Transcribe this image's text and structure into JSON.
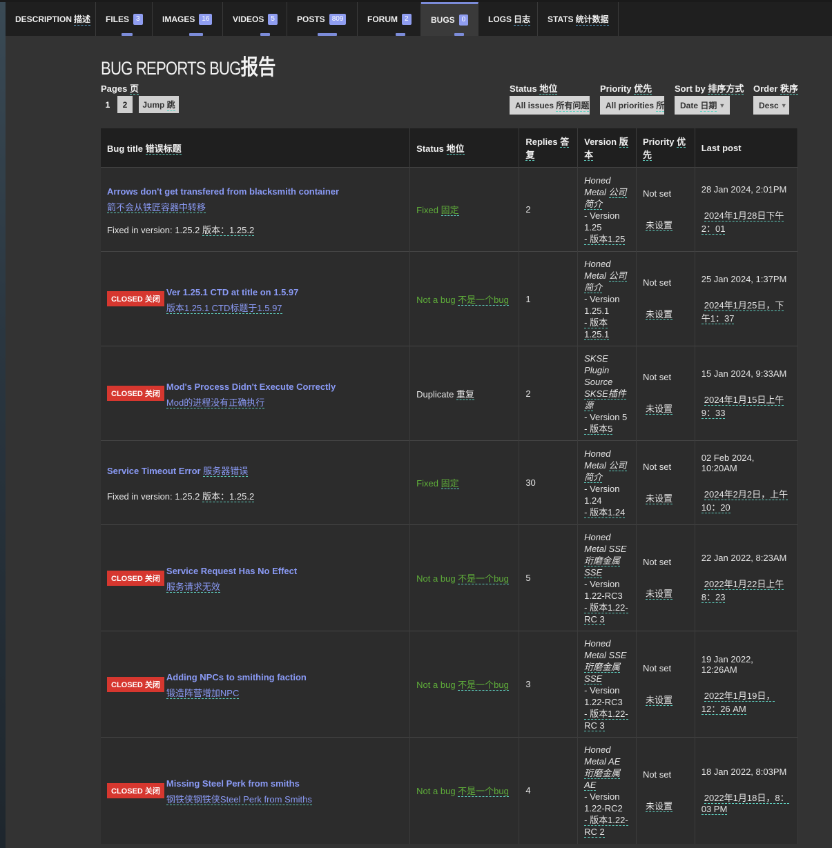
{
  "tabs": [
    {
      "label": "DESCRIPTION",
      "cn": "描述",
      "badge": ""
    },
    {
      "label": "FILES",
      "cn": "",
      "badge": "3"
    },
    {
      "label": "IMAGES",
      "cn": "",
      "badge": "16"
    },
    {
      "label": "VIDEOS",
      "cn": "",
      "badge": "5"
    },
    {
      "label": "POSTS",
      "cn": "",
      "badge": "809"
    },
    {
      "label": "FORUM",
      "cn": "",
      "badge": "2"
    },
    {
      "label": "BUGS",
      "cn": "",
      "badge": "0"
    },
    {
      "label": "LOGS",
      "cn": "日志",
      "badge": ""
    },
    {
      "label": "STATS",
      "cn": "统计数据",
      "badge": ""
    }
  ],
  "heading": {
    "en": "BUG REPORTS BUG",
    "cn": "报告"
  },
  "pages": {
    "label": "Pages",
    "label_cn": "页",
    "current": "1",
    "next": "2",
    "jump": "Jump",
    "jump_cn": "跳"
  },
  "filters": {
    "status": {
      "label": "Status",
      "label_cn": "地位",
      "value": "All issues",
      "value_cn": "所有问题"
    },
    "priority": {
      "label": "Priority",
      "label_cn": "优先",
      "value": "All priorities",
      "value_cn": "所"
    },
    "sort": {
      "label": "Sort by",
      "label_cn": "排序方式",
      "value": "Date",
      "value_cn": "日期"
    },
    "order": {
      "label": "Order",
      "label_cn": "秩序",
      "value": "Desc"
    }
  },
  "columns": {
    "title": {
      "en": "Bug title",
      "cn": "错误标题"
    },
    "status": {
      "en": "Status",
      "cn": "地位"
    },
    "replies": {
      "en": "Replies",
      "cn": "答复"
    },
    "version": {
      "en": "Version",
      "cn": "版本"
    },
    "priority": {
      "en": "Priority",
      "cn": "优先"
    },
    "lastpost": {
      "en": "Last post",
      "cn": ""
    }
  },
  "closed_label": {
    "en": "CLOSED",
    "cn": "关闭"
  },
  "rows": [
    {
      "closed": false,
      "title": "Arrows don't get transfered from blacksmith container",
      "title_cn": "箭不会从铁匠容器中转移",
      "fixed_in": "Fixed in version: 1.25.2",
      "fixed_in_cn": "版本：1.25.2",
      "status": "Fixed",
      "status_cn": "固定",
      "status_type": "fixed",
      "replies": "2",
      "ver_name": "Honed Metal",
      "ver_name_cn": "公司简介",
      "ver_line": "- Version 1.25",
      "ver_line_cn": "- 版本1.25",
      "priority": "Not set",
      "priority_cn": "未设置",
      "lastpost": "28 Jan 2024, 2:01PM",
      "lastpost_cn": "2024年1月28日下午2：01"
    },
    {
      "closed": true,
      "title": "Ver 1.25.1 CTD at title on 1.5.97",
      "title_cn": "版本1.25.1 CTD标题于1.5.97",
      "fixed_in": "",
      "fixed_in_cn": "",
      "status": "Not a bug",
      "status_cn": "不是一个bug",
      "status_type": "notbug",
      "replies": "1",
      "ver_name": "Honed Metal",
      "ver_name_cn": "公司简介",
      "ver_line": "- Version 1.25.1",
      "ver_line_cn": "- 版本1.25.1",
      "priority": "Not set",
      "priority_cn": "未设置",
      "lastpost": "25 Jan 2024, 1:37PM",
      "lastpost_cn": "2024年1月25日，下午1：37"
    },
    {
      "closed": true,
      "title": "Mod's Process Didn't Execute Correctly",
      "title_cn": "Mod的进程没有正确执行",
      "fixed_in": "",
      "fixed_in_cn": "",
      "status": "Duplicate",
      "status_cn": "重复",
      "status_type": "dup",
      "replies": "2",
      "ver_name": "SKSE Plugin Source",
      "ver_name_cn": "SKSE插件源",
      "ver_line": "- Version 5",
      "ver_line_cn": "- 版本5",
      "priority": "Not set",
      "priority_cn": "未设置",
      "lastpost": "15 Jan 2024, 9:33AM",
      "lastpost_cn": "2024年1月15日上午9：33"
    },
    {
      "closed": false,
      "title": "Service Timeout Error",
      "title_cn": "服务器错误",
      "fixed_in": "Fixed in version: 1.25.2",
      "fixed_in_cn": "版本：1.25.2",
      "status": "Fixed",
      "status_cn": "固定",
      "status_type": "fixed",
      "replies": "30",
      "ver_name": "Honed Metal",
      "ver_name_cn": "公司简介",
      "ver_line": "- Version 1.24",
      "ver_line_cn": "- 版本1.24",
      "priority": "Not set",
      "priority_cn": "未设置",
      "lastpost": "02 Feb 2024, 10:20AM",
      "lastpost_cn": "2024年2月2日，上午10：20"
    },
    {
      "closed": true,
      "title": "Service Request Has No Effect",
      "title_cn": "服务请求无效",
      "fixed_in": "",
      "fixed_in_cn": "",
      "status": "Not a bug",
      "status_cn": "不是一个bug",
      "status_type": "notbug",
      "replies": "5",
      "ver_name": "Honed Metal SSE",
      "ver_name_cn": "珩磨金属SSE",
      "ver_line": "- Version 1.22-RC3",
      "ver_line_cn": "- 版本1.22-RC 3",
      "priority": "Not set",
      "priority_cn": "未设置",
      "lastpost": "22 Jan 2022, 8:23AM",
      "lastpost_cn": "2022年1月22日上午8：23"
    },
    {
      "closed": true,
      "title": "Adding NPCs to smithing faction",
      "title_cn": "锻造阵营增加NPC",
      "fixed_in": "",
      "fixed_in_cn": "",
      "status": "Not a bug",
      "status_cn": "不是一个bug",
      "status_type": "notbug",
      "replies": "3",
      "ver_name": "Honed Metal SSE",
      "ver_name_cn": "珩磨金属SSE",
      "ver_line": "- Version 1.22-RC3",
      "ver_line_cn": "- 版本1.22-RC 3",
      "priority": "Not set",
      "priority_cn": "未设置",
      "lastpost": "19 Jan 2022, 12:26AM",
      "lastpost_cn": "2022年1月19日，12：26 AM"
    },
    {
      "closed": true,
      "title": "Missing Steel Perk from smiths",
      "title_cn": "钢铁侠钢铁侠Steel Perk from Smiths",
      "fixed_in": "",
      "fixed_in_cn": "",
      "status": "Not a bug",
      "status_cn": "不是一个bug",
      "status_type": "notbug",
      "replies": "4",
      "ver_name": "Honed Metal AE",
      "ver_name_cn": "珩磨金属AE",
      "ver_line": "- Version 1.22-RC2",
      "ver_line_cn": "- 版本1.22-RC 2",
      "priority": "Not set",
      "priority_cn": "未设置",
      "lastpost": "18 Jan 2022, 8:03PM",
      "lastpost_cn": "2022年1月18日，8：03 PM"
    }
  ],
  "colors": {
    "accent": "#8f9df0",
    "link": "#8a9af5",
    "closed": "#d6372f",
    "status_green": "#5fae3a"
  }
}
